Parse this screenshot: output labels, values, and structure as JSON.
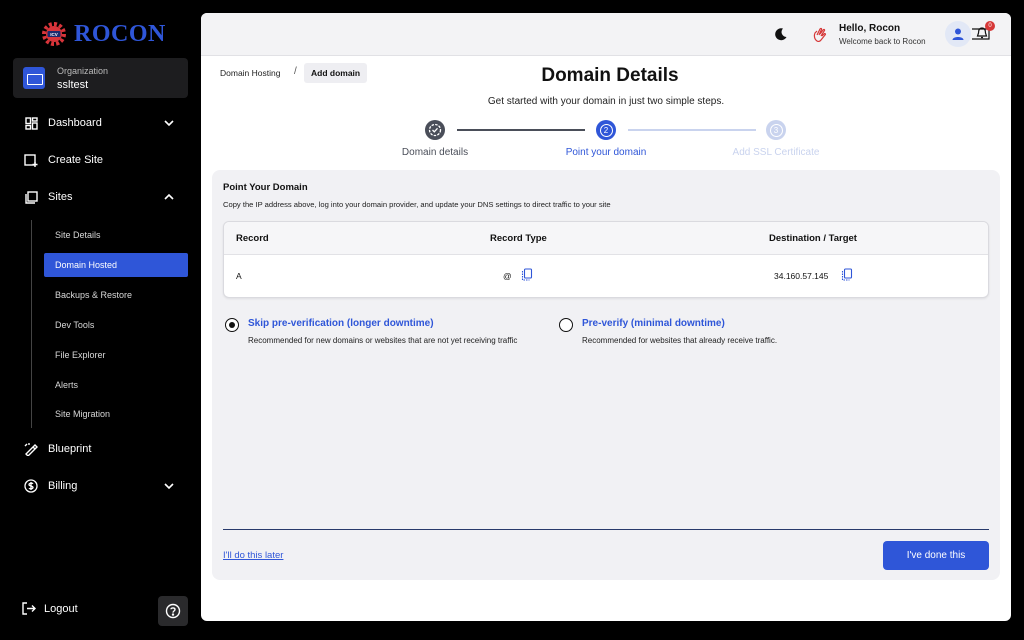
{
  "brand": {
    "name": "ROCON",
    "badge": "ICV"
  },
  "organization": {
    "label": "Organization",
    "name": "ssltest"
  },
  "sidebar": {
    "items": [
      {
        "label": "Dashboard"
      },
      {
        "label": "Create Site"
      },
      {
        "label": "Sites"
      },
      {
        "label": "Blueprint"
      },
      {
        "label": "Billing"
      }
    ],
    "sites_subitems": [
      {
        "label": "Site Details"
      },
      {
        "label": "Domain Hosted"
      },
      {
        "label": "Backups & Restore"
      },
      {
        "label": "Dev Tools"
      },
      {
        "label": "File Explorer"
      },
      {
        "label": "Alerts"
      },
      {
        "label": "Site Migration"
      }
    ],
    "logout": "Logout"
  },
  "header": {
    "greeting": "Hello, Rocon",
    "welcome": "Welcome back to Rocon",
    "notification_count": "0"
  },
  "breadcrumb": {
    "parent": "Domain Hosting",
    "separator": "/",
    "current": "Add domain"
  },
  "page": {
    "title": "Domain Details",
    "subtitle": "Get started with your domain in just two simple steps."
  },
  "steps": [
    {
      "label": "Domain details",
      "number": "1",
      "state": "done"
    },
    {
      "label": "Point your domain",
      "number": "2",
      "state": "active"
    },
    {
      "label": "Add SSL Certificate",
      "number": "3",
      "state": "pending"
    }
  ],
  "point_domain": {
    "title": "Point Your Domain",
    "description": "Copy the IP address above, log into your domain provider, and update your DNS settings to direct traffic to your site",
    "columns": [
      "Record",
      "Record Type",
      "Destination / Target"
    ],
    "row": {
      "record": "A",
      "type": "@",
      "target": "34.160.57.145"
    }
  },
  "options": [
    {
      "title": "Skip pre-verification (longer downtime)",
      "description": "Recommended for new domains or websites that are not yet receiving traffic",
      "selected": true
    },
    {
      "title": "Pre-verify (minimal downtime)",
      "description": "Recommended for websites that already receive traffic.",
      "selected": false
    }
  ],
  "actions": {
    "later": "I'll do this later",
    "done": "I've done this"
  },
  "colors": {
    "accent": "#2f56d8",
    "step_done": "#4a4e59",
    "step_pending": "#c9d3ee"
  }
}
